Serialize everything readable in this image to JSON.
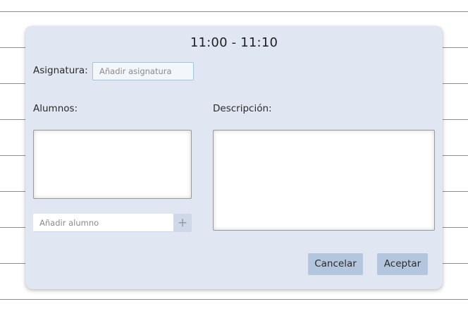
{
  "dialog": {
    "title": "11:00 - 11:10",
    "subject": {
      "label": "Asignatura:",
      "placeholder": "Añadir asignatura"
    },
    "students": {
      "label": "Alumnos:",
      "add_placeholder": "Añadir alumno",
      "add_symbol": "+"
    },
    "description": {
      "label": "Descripción:"
    },
    "buttons": {
      "cancel": "Cancelar",
      "accept": "Aceptar"
    }
  },
  "colors": {
    "dialog_background": "#e1e7f2",
    "button_background": "#b3c6dd",
    "input_focus_border": "#9fc4e4"
  }
}
